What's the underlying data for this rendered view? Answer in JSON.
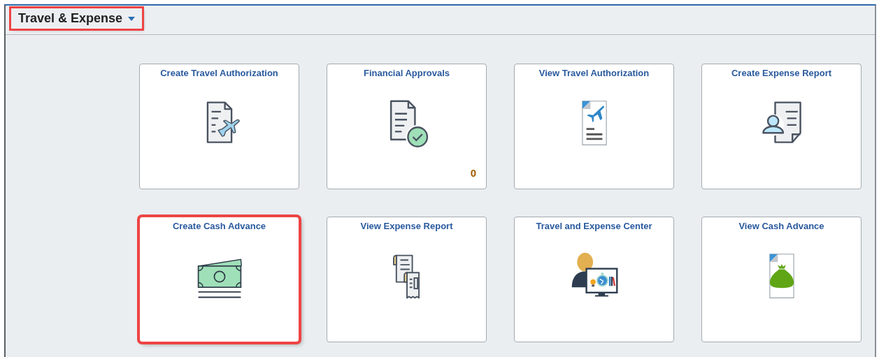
{
  "header": {
    "title": "Travel & Expense",
    "highlighted": true
  },
  "tiles": [
    {
      "title": "Create Travel Authorization",
      "highlighted": false
    },
    {
      "title": "Financial Approvals",
      "count": "0",
      "highlighted": false
    },
    {
      "title": "View Travel Authorization",
      "highlighted": false
    },
    {
      "title": "Create Expense Report",
      "highlighted": false
    },
    {
      "title": "Create Cash Advance",
      "highlighted": true
    },
    {
      "title": "View Expense Report",
      "highlighted": false
    },
    {
      "title": "Travel and Expense Center",
      "highlighted": false
    },
    {
      "title": "View Cash Advance",
      "highlighted": false
    }
  ]
}
